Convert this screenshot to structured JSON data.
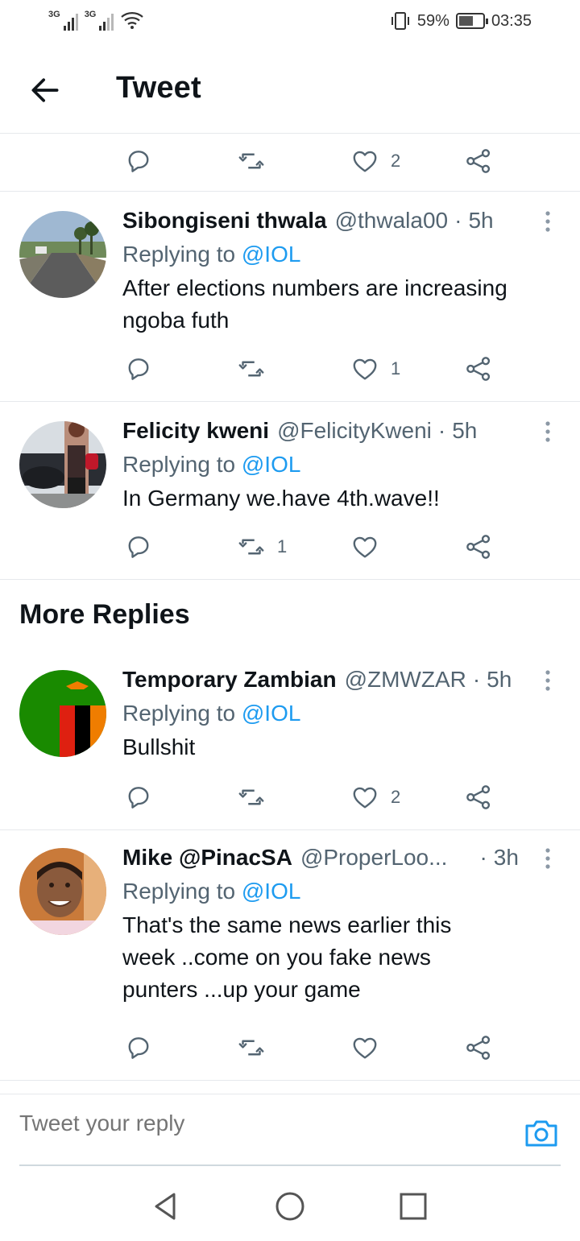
{
  "status_bar": {
    "network1": "3G",
    "network2": "3G",
    "battery_percent": "59%",
    "battery_level": 0.59,
    "time": "03:35"
  },
  "header": {
    "title": "Tweet"
  },
  "top_actions": {
    "like_count": "2"
  },
  "replies": [
    {
      "name": "Sibongiseni thwala",
      "handle": "@thwala00",
      "time": "5h",
      "replying_prefix": "Replying to",
      "replying_to": "@IOL",
      "text_lines": [
        "After elections numbers are increasing",
        "ngoba futh"
      ],
      "retweet_count": "",
      "like_count": "1"
    },
    {
      "name": "Felicity kweni",
      "handle": "@FelicityKweni",
      "time": "5h",
      "replying_prefix": "Replying to",
      "replying_to": "@IOL",
      "text_lines": [
        "In Germany we.have 4th.wave!!"
      ],
      "retweet_count": "1",
      "like_count": ""
    }
  ],
  "more_replies": {
    "heading": "More Replies",
    "items": [
      {
        "name": "Temporary Zambian",
        "handle": "@ZMWZAR",
        "time": "5h",
        "replying_prefix": "Replying to",
        "replying_to": "@IOL",
        "text_lines": [
          "Bullshit"
        ],
        "retweet_count": "",
        "like_count": "2"
      },
      {
        "name": "Mike @PinacSA",
        "handle": "@ProperLoo...",
        "time": "3h",
        "replying_prefix": "Replying to",
        "replying_to": "@IOL",
        "text_lines": [
          "That's the same news earlier this",
          "week ..come on you fake news",
          "punters ...up your game"
        ],
        "retweet_count": "",
        "like_count": ""
      }
    ]
  },
  "compose": {
    "placeholder": "Tweet your reply"
  },
  "icons": {
    "back": "arrow-left-icon",
    "reply": "comment-icon",
    "retweet": "retweet-icon",
    "like": "heart-icon",
    "share": "share-icon",
    "more": "more-vertical-icon",
    "camera": "camera-icon"
  },
  "colors": {
    "accent": "#1d9bf0",
    "secondary_text": "#536471",
    "divider": "#e6e9ec"
  }
}
